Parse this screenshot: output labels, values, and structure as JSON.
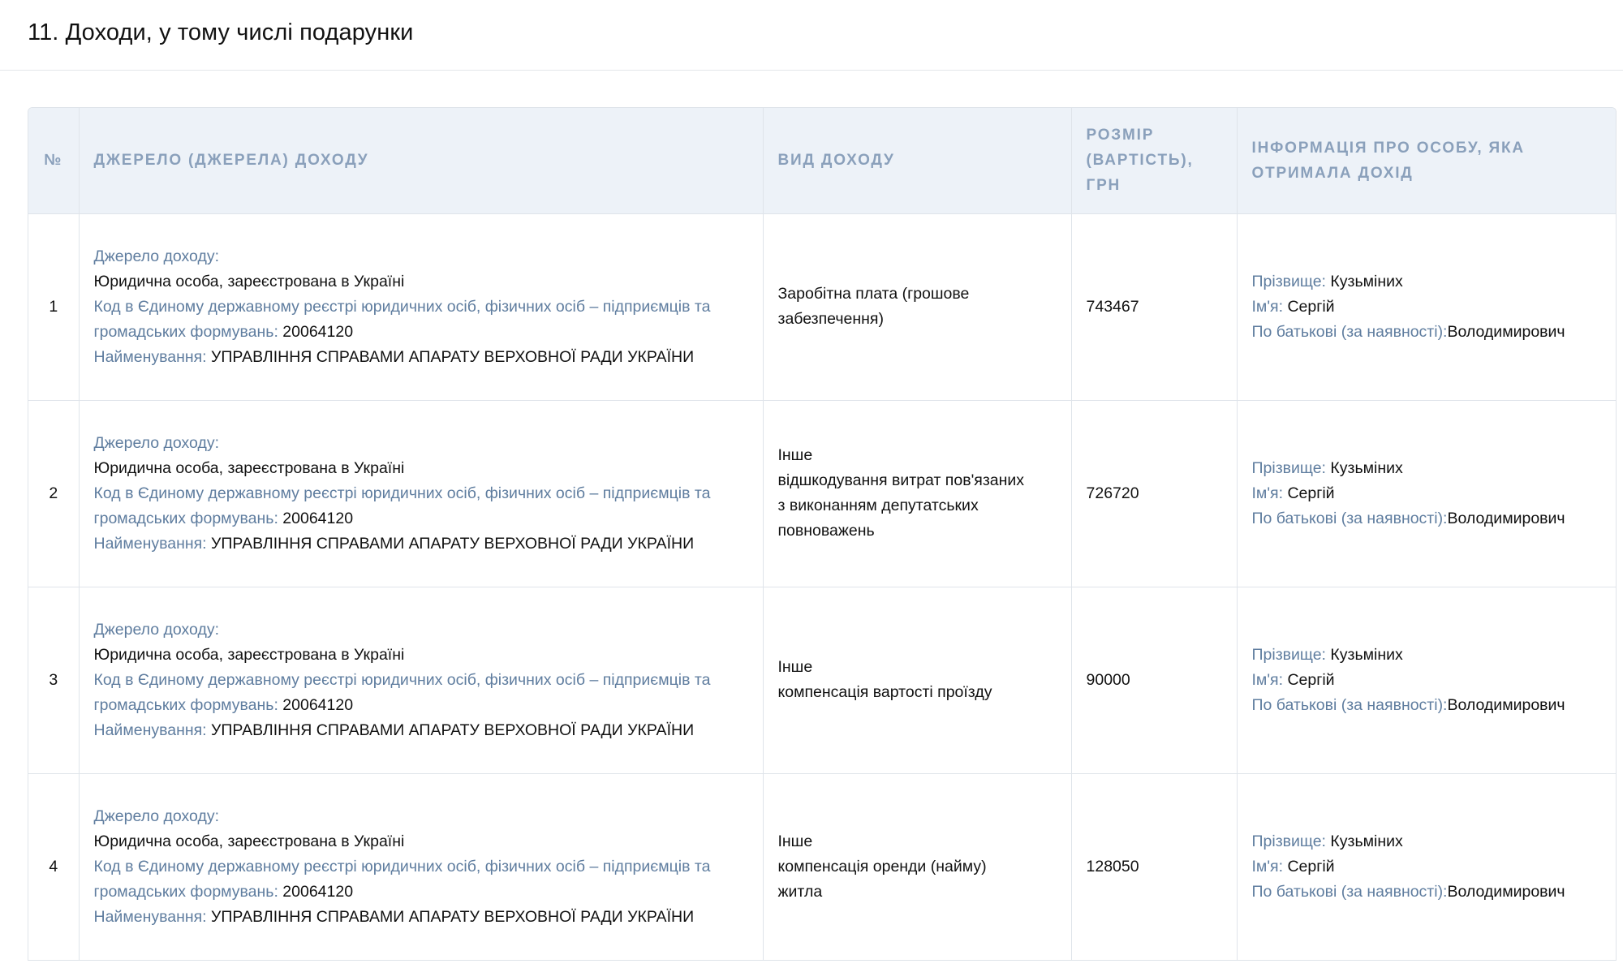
{
  "section_title": "11. Доходи, у тому числі подарунки",
  "table": {
    "headers": {
      "num": "№",
      "source": "Джерело (джерела) доходу",
      "type": "Вид доходу",
      "amount": "Розмір (вартість), грн",
      "recipient": "Інформація про особу, яка отримала дохід"
    },
    "labels": {
      "source": "Джерело доходу:",
      "code": "Код в Єдиному державному реєстрі юридичних осіб, фізичних осіб – підприємців та громадських формувань:",
      "name": "Найменування:",
      "surname": "Прізвище:",
      "first_name": "Ім'я:",
      "patronymic": "По батькові (за наявності):"
    },
    "rows": [
      {
        "num": "1",
        "source_type": "Юридична особа, зареєстрована в Україні",
        "code": "20064120",
        "name": "УПРАВЛІННЯ СПРАВАМИ АПАРАТУ ВЕРХОВНОЇ РАДИ УКРАЇНИ",
        "income_type": [
          "Заробітна плата (грошове",
          "забезпечення)"
        ],
        "amount": "743467",
        "surname": "Кузьміних",
        "first_name": "Сергій",
        "patronymic": "Володимирович"
      },
      {
        "num": "2",
        "source_type": "Юридична особа, зареєстрована в Україні",
        "code": "20064120",
        "name": "УПРАВЛІННЯ СПРАВАМИ АПАРАТУ ВЕРХОВНОЇ РАДИ УКРАЇНИ",
        "income_type": [
          "Інше",
          "відшкодування витрат пов'язаних",
          "з виконанням депутатських",
          "повноважень"
        ],
        "amount": "726720",
        "surname": "Кузьміних",
        "first_name": "Сергій",
        "patronymic": "Володимирович"
      },
      {
        "num": "3",
        "source_type": "Юридична особа, зареєстрована в Україні",
        "code": "20064120",
        "name": "УПРАВЛІННЯ СПРАВАМИ АПАРАТУ ВЕРХОВНОЇ РАДИ УКРАЇНИ",
        "income_type": [
          "Інше",
          "компенсація вартості проїзду"
        ],
        "amount": "90000",
        "surname": "Кузьміних",
        "first_name": "Сергій",
        "patronymic": "Володимирович"
      },
      {
        "num": "4",
        "source_type": "Юридична особа, зареєстрована в Україні",
        "code": "20064120",
        "name": "УПРАВЛІННЯ СПРАВАМИ АПАРАТУ ВЕРХОВНОЇ РАДИ УКРАЇНИ",
        "income_type": [
          "Інше",
          "компенсація оренди (найму)",
          "житла"
        ],
        "amount": "128050",
        "surname": "Кузьміних",
        "first_name": "Сергій",
        "patronymic": "Володимирович"
      }
    ]
  }
}
